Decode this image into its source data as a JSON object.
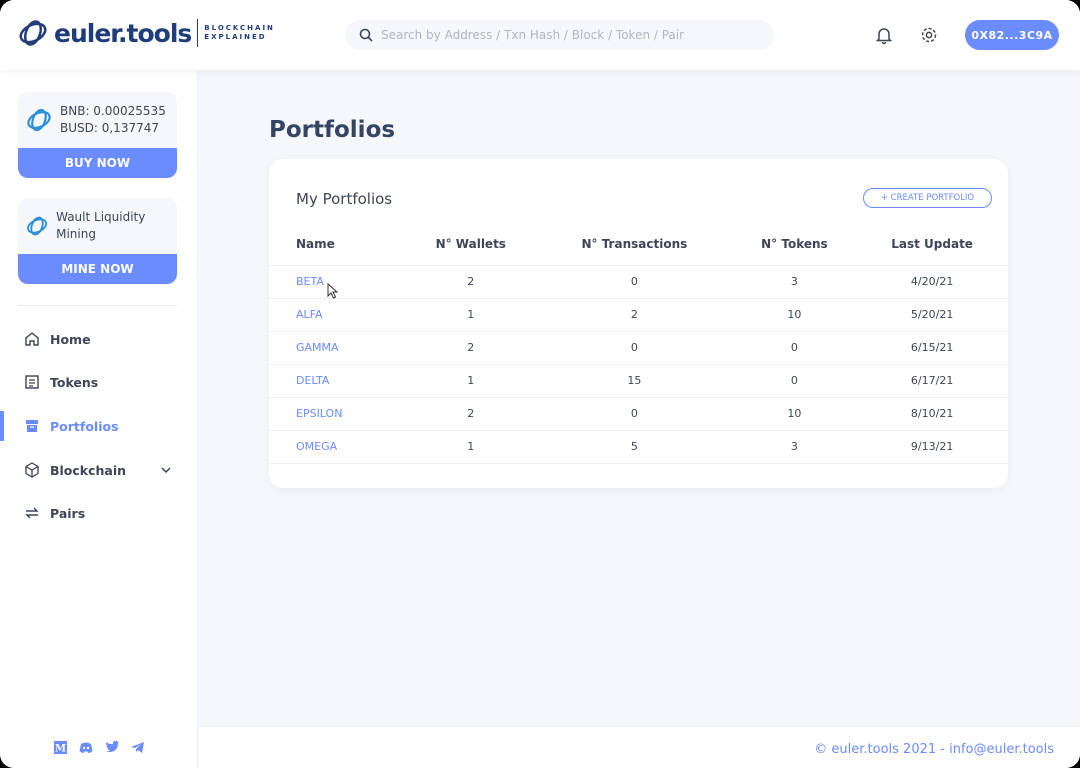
{
  "header": {
    "logo_text": "euler.tools",
    "logo_tagline_1": "BLOCKCHAIN",
    "logo_tagline_2": "EXPLAINED",
    "search_placeholder": "Search by Address / Txn Hash / Block / Token / Pair",
    "wallet": "0X82...3C9A"
  },
  "sidebar": {
    "balance_card": {
      "bnb": "BNB: 0.00025535",
      "busd": "BUSD: 0,137747",
      "button": "BUY NOW"
    },
    "mining_card": {
      "text": "Wault Liquidity Mining",
      "button": "MINE NOW"
    },
    "nav": [
      {
        "label": "Home"
      },
      {
        "label": "Tokens"
      },
      {
        "label": "Portfolios"
      },
      {
        "label": "Blockchain"
      },
      {
        "label": "Pairs"
      }
    ]
  },
  "main": {
    "title": "Portfolios",
    "panel_title": "My Portfolios",
    "create_button": "+ CREATE PORTFOLIO",
    "columns": [
      "Name",
      "N° Wallets",
      "N° Transactions",
      "N° Tokens",
      "Last Update"
    ],
    "rows": [
      [
        "BETA",
        "2",
        "0",
        "3",
        "4/20/21"
      ],
      [
        "ALFA",
        "1",
        "2",
        "10",
        "5/20/21"
      ],
      [
        "GAMMA",
        "2",
        "0",
        "0",
        "6/15/21"
      ],
      [
        "DELTA",
        "1",
        "15",
        "0",
        "6/17/21"
      ],
      [
        "EPSILON",
        "2",
        "0",
        "10",
        "8/10/21"
      ],
      [
        "OMEGA",
        "1",
        "5",
        "3",
        "9/13/21"
      ]
    ]
  },
  "footer": {
    "text": "© euler.tools 2021 - info@euler.tools"
  },
  "colors": {
    "accent": "#6b8cff",
    "dark": "#1f3d7a"
  }
}
